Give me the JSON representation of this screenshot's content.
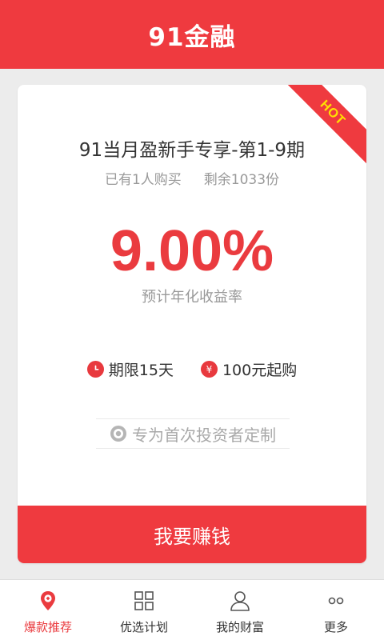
{
  "header": {
    "title": "91金融"
  },
  "product": {
    "badge": "HOT",
    "title": "91当月盈新手专享-第1-9期",
    "purchased": "已有1人购买",
    "remaining": "剩余1033份",
    "rate": "9.00%",
    "rate_label": "预计年化收益率",
    "term_label": "期限15天",
    "min_amount_label": "100元起购",
    "yen_symbol": "¥",
    "target_text": "专为首次投资者定制",
    "cta_label": "我要赚钱"
  },
  "tabs": [
    {
      "label": "爆款推荐",
      "icon": "location-pin-icon",
      "active": true
    },
    {
      "label": "优选计划",
      "icon": "grid-icon",
      "active": false
    },
    {
      "label": "我的财富",
      "icon": "user-icon",
      "active": false
    },
    {
      "label": "更多",
      "icon": "more-dots-icon",
      "active": false
    }
  ],
  "colors": {
    "accent": "#ef3a3f",
    "badge_text": "#ffe100",
    "background": "#ececec"
  }
}
